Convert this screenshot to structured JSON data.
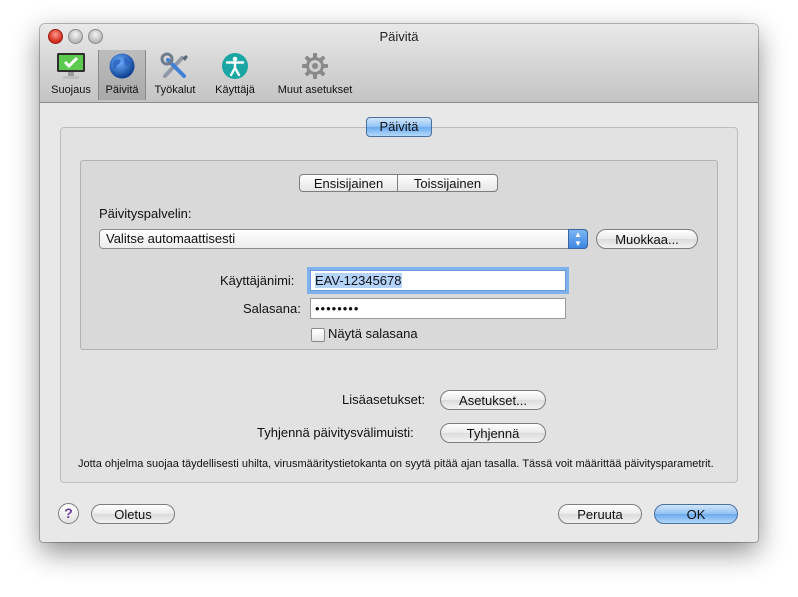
{
  "window": {
    "title": "Päivitä"
  },
  "toolbar": {
    "items": [
      {
        "label": "Suojaus",
        "icon": "monitor-check-icon"
      },
      {
        "label": "Päivitä",
        "icon": "globe-icon",
        "selected": true
      },
      {
        "label": "Työkalut",
        "icon": "tools-icon"
      },
      {
        "label": "Käyttäjä",
        "icon": "user-accessibility-icon"
      },
      {
        "label": "Muut asetukset",
        "icon": "gear-icon"
      }
    ]
  },
  "main": {
    "section_button": "Päivitä",
    "tabs": [
      {
        "label": "Ensisijainen",
        "selected": true
      },
      {
        "label": "Toissijainen",
        "selected": false
      }
    ],
    "update_server_label": "Päivityspalvelin:",
    "update_server_value": "Valitse automaattisesti",
    "edit_button": "Muokkaa...",
    "username_label": "Käyttäjänimi:",
    "username_value": "EAV-12345678",
    "password_label": "Salasana:",
    "password_value": "••••••••",
    "show_password_label": "Näytä salasana",
    "show_password_checked": false,
    "advanced_label": "Lisäasetukset:",
    "advanced_button": "Asetukset...",
    "clear_cache_label": "Tyhjennä päivitysvälimuisti:",
    "clear_cache_button": "Tyhjennä",
    "info_text": "Jotta ohjelma suojaa täydellisesti uhilta, virusmääritystietokanta on syytä pitää ajan tasalla. Tässä voit määrittää päivitysparametrit."
  },
  "footer": {
    "help_label": "?",
    "default_button": "Oletus",
    "cancel_button": "Peruuta",
    "ok_button": "OK"
  },
  "colors": {
    "accent": "#6aa9ee",
    "focus_ring": "#7fb2ec"
  }
}
